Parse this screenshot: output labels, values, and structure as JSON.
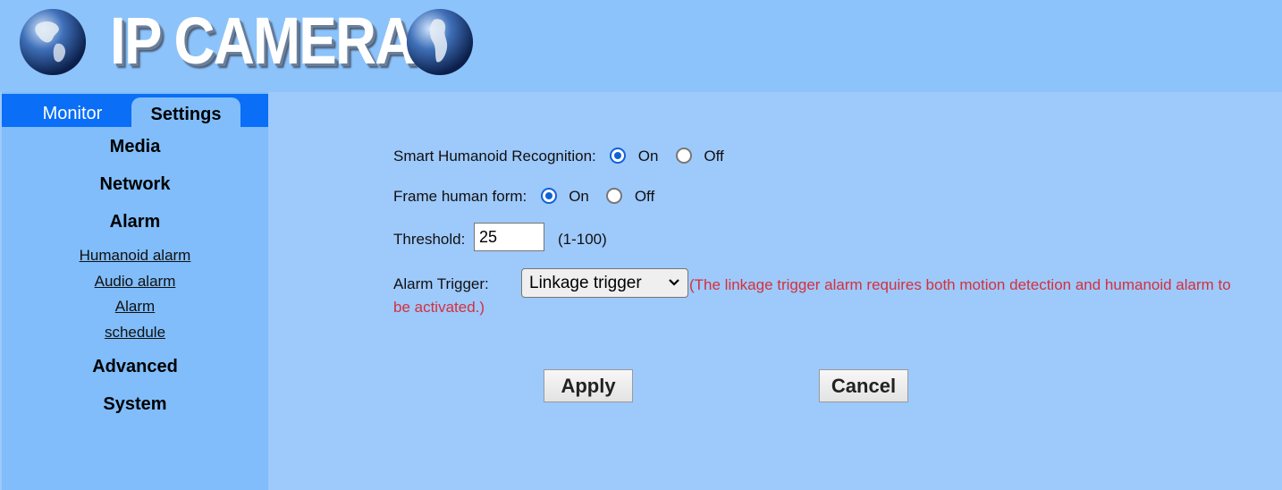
{
  "header": {
    "logo_text": "IP CAMERA"
  },
  "tabs": {
    "monitor": "Monitor",
    "settings": "Settings"
  },
  "sidebar": {
    "sections": [
      "Media",
      "Network",
      "Alarm",
      "Advanced",
      "System"
    ],
    "alarm_items": [
      "Humanoid alarm",
      "Audio alarm",
      "Alarm",
      "schedule"
    ]
  },
  "form": {
    "smart_recognition": {
      "label": "Smart Humanoid Recognition:",
      "on": "On",
      "off": "Off",
      "selected": "On"
    },
    "frame_human": {
      "label": "Frame human form:",
      "on": "On",
      "off": "Off",
      "selected": "On"
    },
    "threshold": {
      "label": "Threshold:",
      "value": "25",
      "range": "(1-100)"
    },
    "alarm_trigger": {
      "label": "Alarm Trigger:",
      "selected": "Linkage trigger",
      "note": "(The linkage trigger alarm requires both motion detection and humanoid alarm to be activated.)"
    }
  },
  "buttons": {
    "apply": "Apply",
    "cancel": "Cancel"
  },
  "colors": {
    "header_bg": "#8cc3fb",
    "sidebar_bg": "#80bdfa",
    "main_bg": "#9ec9fb",
    "tab_bar": "#0a6ef6",
    "note_text": "#d4303c",
    "radio_accent": "#1062d6"
  },
  "icons": [
    "globe-icon",
    "chevron-down-icon"
  ]
}
